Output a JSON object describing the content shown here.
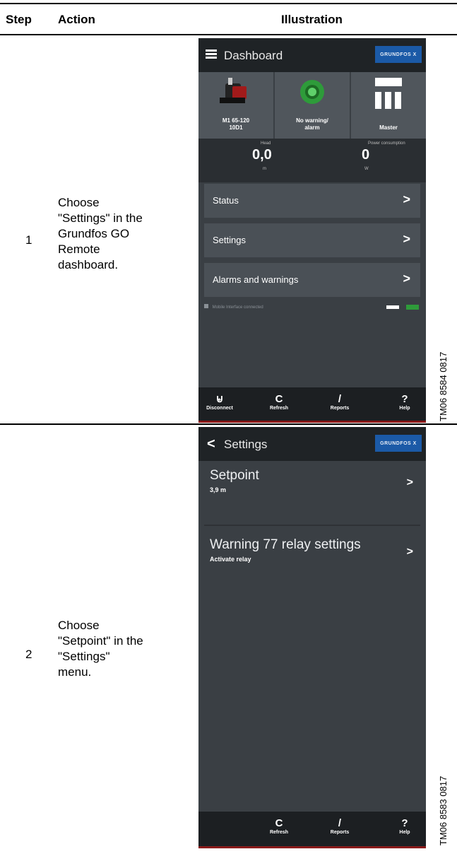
{
  "table": {
    "headers": {
      "step": "Step",
      "action": "Action",
      "illustration": "Illustration"
    },
    "rows": [
      {
        "step": "1",
        "action_lines": [
          "Choose",
          "\"Settings\" in the",
          "Grundfos GO",
          "Remote",
          "dashboard."
        ],
        "figure_code": "TM06 8584 0817",
        "screen": {
          "title": "Dashboard",
          "brand": "GRUNDFOS X",
          "tiles": [
            {
              "label_line1": "M1 65-120",
              "label_line2": "10D1",
              "icon": "pump-icon"
            },
            {
              "label_line1": "No warning/",
              "label_line2": "alarm",
              "icon": "status-ok-icon"
            },
            {
              "label_line1": "Master",
              "label_line2": "",
              "icon": "multi-pump-icon"
            }
          ],
          "metrics": [
            {
              "label": "Head",
              "value": "0,0",
              "unit": "m"
            },
            {
              "label": "Power consumption",
              "value": "0",
              "unit": "W"
            }
          ],
          "menu": [
            {
              "label": "Status"
            },
            {
              "label": "Settings"
            },
            {
              "label": "Alarms and warnings"
            }
          ],
          "status_text": "Mobile Interface connected",
          "bottom_bar": [
            {
              "label": "Disconnect",
              "icon": "disconnect-icon"
            },
            {
              "label": "Refresh",
              "icon": "refresh-icon"
            },
            {
              "label": "Reports",
              "icon": "reports-icon"
            },
            {
              "label": "Help",
              "icon": "help-icon"
            }
          ]
        }
      },
      {
        "step": "2",
        "action_lines": [
          "Choose",
          "\"Setpoint\" in the",
          "\"Settings\"",
          "menu."
        ],
        "figure_code": "TM06 8583 0817",
        "screen": {
          "title": "Settings",
          "brand": "GRUNDFOS X",
          "items": [
            {
              "title": "Setpoint",
              "sub": "3,9 m"
            },
            {
              "title": "Warning 77 relay settings",
              "sub": "Activate relay"
            }
          ],
          "bottom_bar": [
            {
              "label": "Refresh",
              "icon": "refresh-icon"
            },
            {
              "label": "Reports",
              "icon": "reports-icon"
            },
            {
              "label": "Help",
              "icon": "help-icon"
            }
          ]
        }
      }
    ]
  },
  "colors": {
    "screen_bg": "#3a3f44",
    "app_bar": "#1f2326",
    "brand_blue": "#1b5aa7",
    "accent_green": "#2e9b3a",
    "accent_red": "#8a1a1a"
  }
}
